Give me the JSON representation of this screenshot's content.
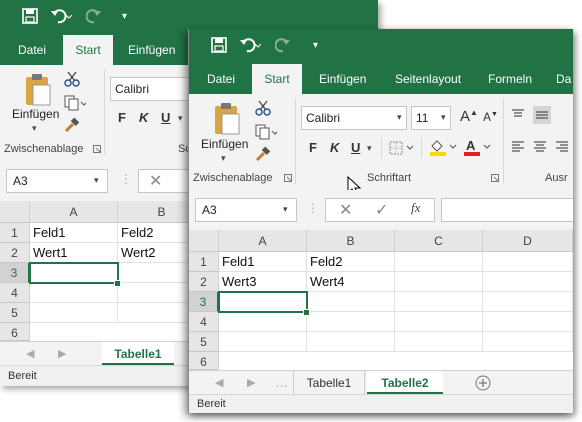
{
  "accent": "#217346",
  "back_window": {
    "tabs": [
      "Datei",
      "Start",
      "Einfügen"
    ],
    "clipboard_label": "Einfügen",
    "group_label": "Zwischenablage",
    "font_name": "Calibri",
    "font_group_partial": "Sc",
    "name_box": "A3",
    "columns": [
      "A",
      "B"
    ],
    "rows": [
      "1",
      "2",
      "3",
      "4",
      "5",
      "6"
    ],
    "cells": {
      "A1": "Feld1",
      "B1": "Feld2",
      "A2": "Wert1",
      "B2": "Wert2"
    },
    "sheet_tab": "Tabelle1",
    "status": "Bereit"
  },
  "front_window": {
    "tabs": [
      "Datei",
      "Start",
      "Einfügen",
      "Seitenlayout",
      "Formeln",
      "Da"
    ],
    "clipboard_label": "Einfügen",
    "clipboard_group": "Zwischenablage",
    "font_name": "Calibri",
    "font_size": "11",
    "font_group": "Schriftart",
    "align_group_partial": "Ausr",
    "name_box": "A3",
    "fx_label": "fx",
    "columns": [
      "A",
      "B",
      "C",
      "D"
    ],
    "rows": [
      "1",
      "2",
      "3",
      "4",
      "5",
      "6"
    ],
    "cells": {
      "A1": "Feld1",
      "B1": "Feld2",
      "A2": "Wert3",
      "B2": "Wert4"
    },
    "sheet_tabs": [
      "Tabelle1",
      "Tabelle2"
    ],
    "active_sheet": "Tabelle2",
    "status": "Bereit"
  }
}
